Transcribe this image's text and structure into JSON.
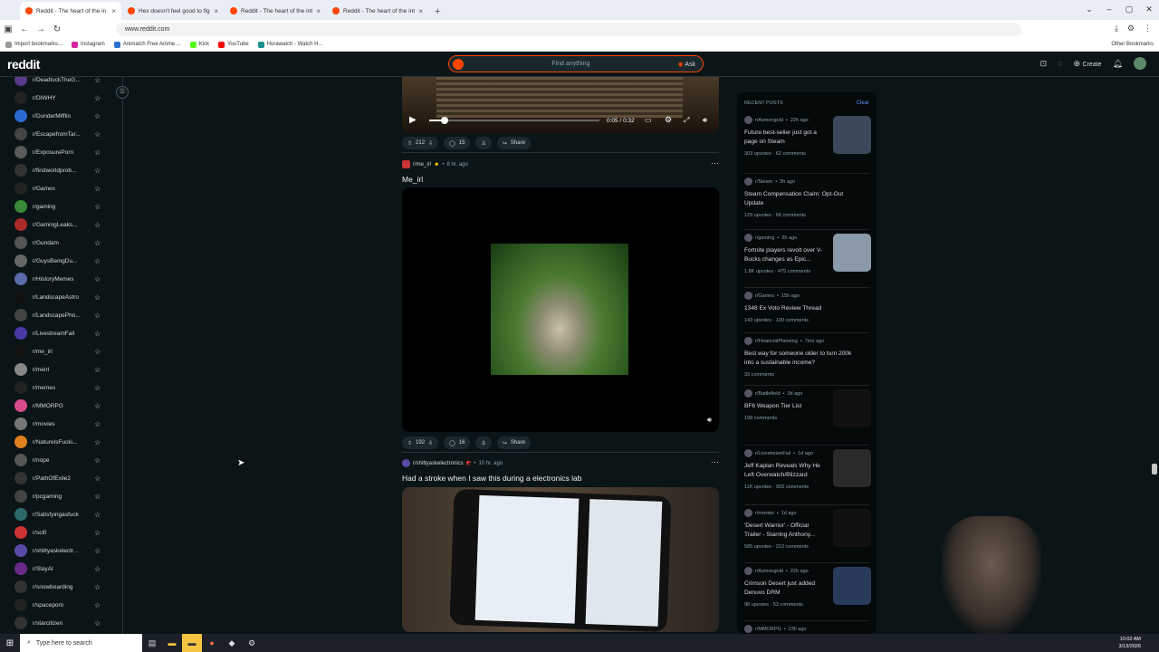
{
  "browser": {
    "tabs": [
      {
        "title": "Reddit - The heart of the in",
        "active": true
      },
      {
        "title": "Hex doesn't feel good to fight",
        "active": false
      },
      {
        "title": "Reddit - The heart of the intern",
        "active": false
      },
      {
        "title": "Reddit - The heart of the intern",
        "active": false
      }
    ],
    "url": "www.reddit.com",
    "bookmarks": [
      "Import bookmarks...",
      "Instagram",
      "Animatch Free Anime ...",
      "Kick",
      "YouTube",
      "Hurawatch - Watch H..."
    ],
    "other_bookmarks": "Other Bookmarks"
  },
  "header": {
    "logo": "reddit",
    "search_placeholder": "Find anything",
    "ask_label": "Ask",
    "create_label": "Create"
  },
  "sidebar": {
    "items": [
      "r/DeadlockTheG...",
      "r/DIWHY",
      "r/DunderMifflin",
      "r/EscapefromTar...",
      "r/ExposurePorn",
      "r/firstworldprob...",
      "r/Games",
      "r/gaming",
      "r/GamingLeaks...",
      "r/Gundam",
      "r/GuysBeingDu...",
      "r/HistoryMemes",
      "r/LandscapeAstro",
      "r/LandscapePho...",
      "r/LivestreamFail",
      "r/me_irl",
      "r/meirl",
      "r/memes",
      "r/MMORPG",
      "r/movies",
      "r/NatureIsFucki...",
      "r/nope",
      "r/PathOfExile2",
      "r/pcgaming",
      "r/Satisfyingasfuck",
      "r/scifi",
      "r/shittyaskelectr...",
      "r/SlayAI",
      "r/snowboarding",
      "r/spaceporn",
      "r/starcitizen"
    ]
  },
  "feed": {
    "video1": {
      "time": "0:05 / 0:32",
      "upvotes": "212",
      "comments": "15",
      "share": "Share",
      "progress": 0.09
    },
    "post2": {
      "subreddit": "r/me_irl",
      "age": "8 hr. ago",
      "title": "Me_irl",
      "upvotes": "192",
      "comments": "16",
      "share": "Share"
    },
    "post3": {
      "subreddit": "r/shittyaskelectronics",
      "age": "10 hr. ago",
      "title": "Had a stroke when I saw this during a electronics lab"
    }
  },
  "recent": {
    "heading": "RECENT POSTS",
    "clear": "Clear",
    "posts": [
      {
        "sub": "r/Asmongold",
        "age": "22h ago",
        "title": "Future best-seller just got a page on Steam",
        "stats": "303 upvotes · 62 comments",
        "thumb": true
      },
      {
        "sub": "r/Steam",
        "age": "3h ago",
        "title": "Steam Compensation Claim: Opt-Out Update",
        "stats": "129 upvotes · 66 comments",
        "thumb": false
      },
      {
        "sub": "r/gaming",
        "age": "2h ago",
        "title": "Fortnite players revolt over V-Bucks changes as Epic...",
        "stats": "1.8K upvotes · 475 comments",
        "thumb": true
      },
      {
        "sub": "r/Games",
        "age": "15h ago",
        "title": "1348 Ex Voto Review Thread",
        "stats": "143 upvotes · 190 comments",
        "thumb": false
      },
      {
        "sub": "r/FinancialPlanning",
        "age": "7mo ago",
        "title": "Best way for someone older to turn 200k into a sustainable income?",
        "stats": "33 comments",
        "thumb": false
      },
      {
        "sub": "r/Battlefield",
        "age": "3d ago",
        "title": "BF6 Weapon Tier List",
        "stats": "198 comments",
        "thumb": true
      },
      {
        "sub": "r/LivestreamFail",
        "age": "1d ago",
        "title": "Jeff Kaplan Reveals Why He Left Overwatch/Blizzard",
        "stats": "11K upvotes · 903 comments",
        "thumb": true
      },
      {
        "sub": "r/movies",
        "age": "1d ago",
        "title": "'Desert Warrior' - Official Trailer - Starring Anthony...",
        "stats": "585 upvotes · 213 comments",
        "thumb": true
      },
      {
        "sub": "r/Asmongold",
        "age": "22h ago",
        "title": "Crimson Desert just added Denuvo DRM",
        "stats": "98 upvotes · 53 comments",
        "thumb": true
      },
      {
        "sub": "r/MMORPG",
        "age": "23h ago",
        "title": "",
        "stats": "",
        "thumb": false
      }
    ]
  },
  "taskbar": {
    "search": "Type here to search",
    "time": "10:02 AM",
    "date": "3/13/2026"
  }
}
